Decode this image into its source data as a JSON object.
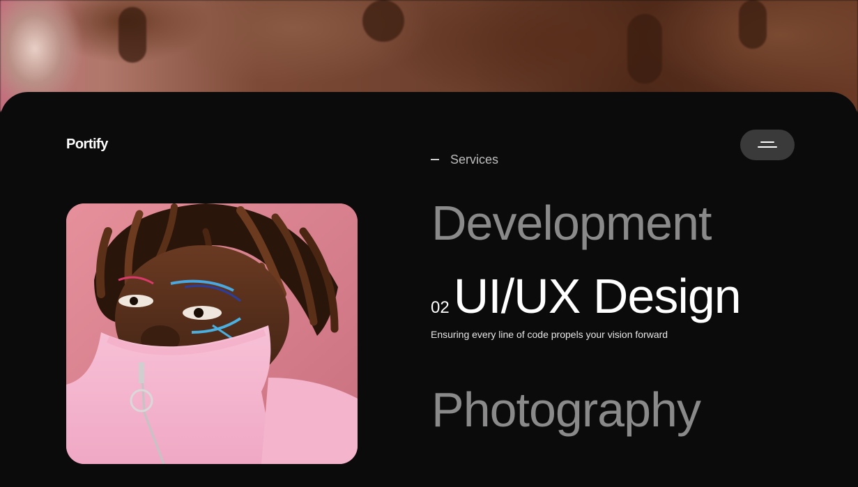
{
  "brand": {
    "name": "Portify"
  },
  "menu": {
    "icon": "hamburger-menu-icon"
  },
  "services": {
    "section_label": "Services",
    "items": [
      {
        "title": "Development"
      },
      {
        "number": "02",
        "title": "UI/UX Design",
        "description": "Ensuring every line of code propels your vision forward"
      },
      {
        "title": "Photography"
      }
    ]
  },
  "colors": {
    "background": "#0c0b0b",
    "text_active": "#ffffff",
    "text_inactive": "#8a8a8a",
    "menu_button": "#3a3a3a",
    "portrait_background": "#d8818f"
  }
}
